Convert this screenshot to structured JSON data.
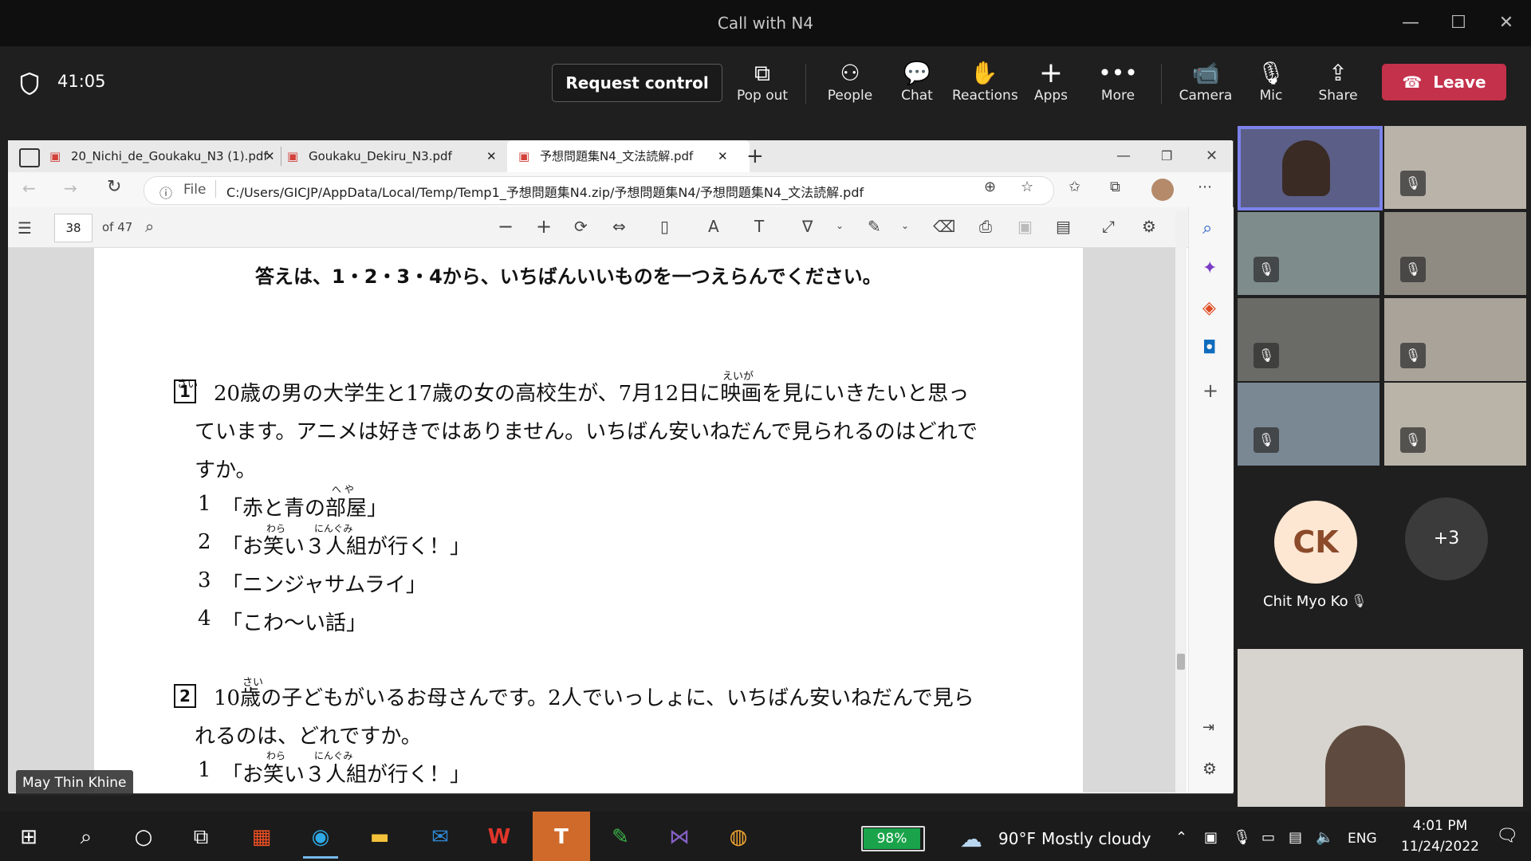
{
  "window": {
    "title": "Call with N4"
  },
  "toolbar": {
    "timer": "41:05",
    "request_control": "Request control",
    "buttons": [
      {
        "label": "Pop out",
        "icon": "pop-out-icon"
      },
      {
        "label": "People",
        "icon": "people-icon"
      },
      {
        "label": "Chat",
        "icon": "chat-icon"
      },
      {
        "label": "Reactions",
        "icon": "reactions-icon"
      },
      {
        "label": "Apps",
        "icon": "plus-icon"
      },
      {
        "label": "More",
        "icon": "more-icon"
      },
      {
        "label": "Camera",
        "icon": "camera-icon"
      },
      {
        "label": "Mic",
        "icon": "mic-off-icon"
      },
      {
        "label": "Share",
        "icon": "share-icon"
      }
    ],
    "leave": "Leave",
    "leave_color": "#c4314b"
  },
  "browser": {
    "tabs": [
      {
        "label": "20_Nichi_de_Goukaku_N3 (1).pdf"
      },
      {
        "label": "Goukaku_Dekiru_N3.pdf"
      },
      {
        "label": "予想問題集N4_文法読解.pdf"
      }
    ],
    "address_prefix": "File",
    "address": "C:/Users/GICJP/AppData/Local/Temp/Temp1_予想問題集N4.zip/予想問題集N4/予想問題集N4_文法読解.pdf",
    "page_number": "38",
    "page_total": "of 47"
  },
  "document": {
    "instruction": "答えは、1・2・3・4から、いちばんいいものを一つえらんでください。",
    "q1": {
      "number": "1",
      "furigana_sai": "さい",
      "furigana_eiga": "えいが",
      "line1": "20歳の男の大学生と17歳の女の高校生が、7月12日に映画を見にいきたいと思っ",
      "line2": "ています。アニメは好きではありません。いちばん安いねだんで見られるのはどれで",
      "line3": "すか。",
      "options": [
        {
          "num": "1",
          "text": "「赤と青の部屋」",
          "ruby": "へ や"
        },
        {
          "num": "2",
          "text": "「お笑い３人組が行く！」",
          "ruby": "わら　　　にんぐみ"
        },
        {
          "num": "3",
          "text": "「ニンジャサムライ」",
          "ruby": ""
        },
        {
          "num": "4",
          "text": "「こわ～い話」",
          "ruby": ""
        }
      ]
    },
    "q2": {
      "number": "2",
      "furigana_sai": "さい",
      "line1": "10歳の子どもがいるお母さんです。2人でいっしょに、いちばん安いねだんで見ら",
      "line2": "れるのは、どれですか。",
      "option1_num": "1",
      "option1_text": "「お笑い３人組が行く！」",
      "option1_ruby": "わら　　　にんぐみ"
    }
  },
  "presenter_label": "May Thin Khine",
  "participants": {
    "avatar_initials": "CK",
    "avatar_name": "Chit Myo Ko",
    "overflow": "+3"
  },
  "taskbar": {
    "battery": "98%",
    "temperature": "90°F",
    "weather": "Mostly cloudy",
    "language": "ENG",
    "time": "4:01 PM",
    "date": "11/24/2022"
  }
}
